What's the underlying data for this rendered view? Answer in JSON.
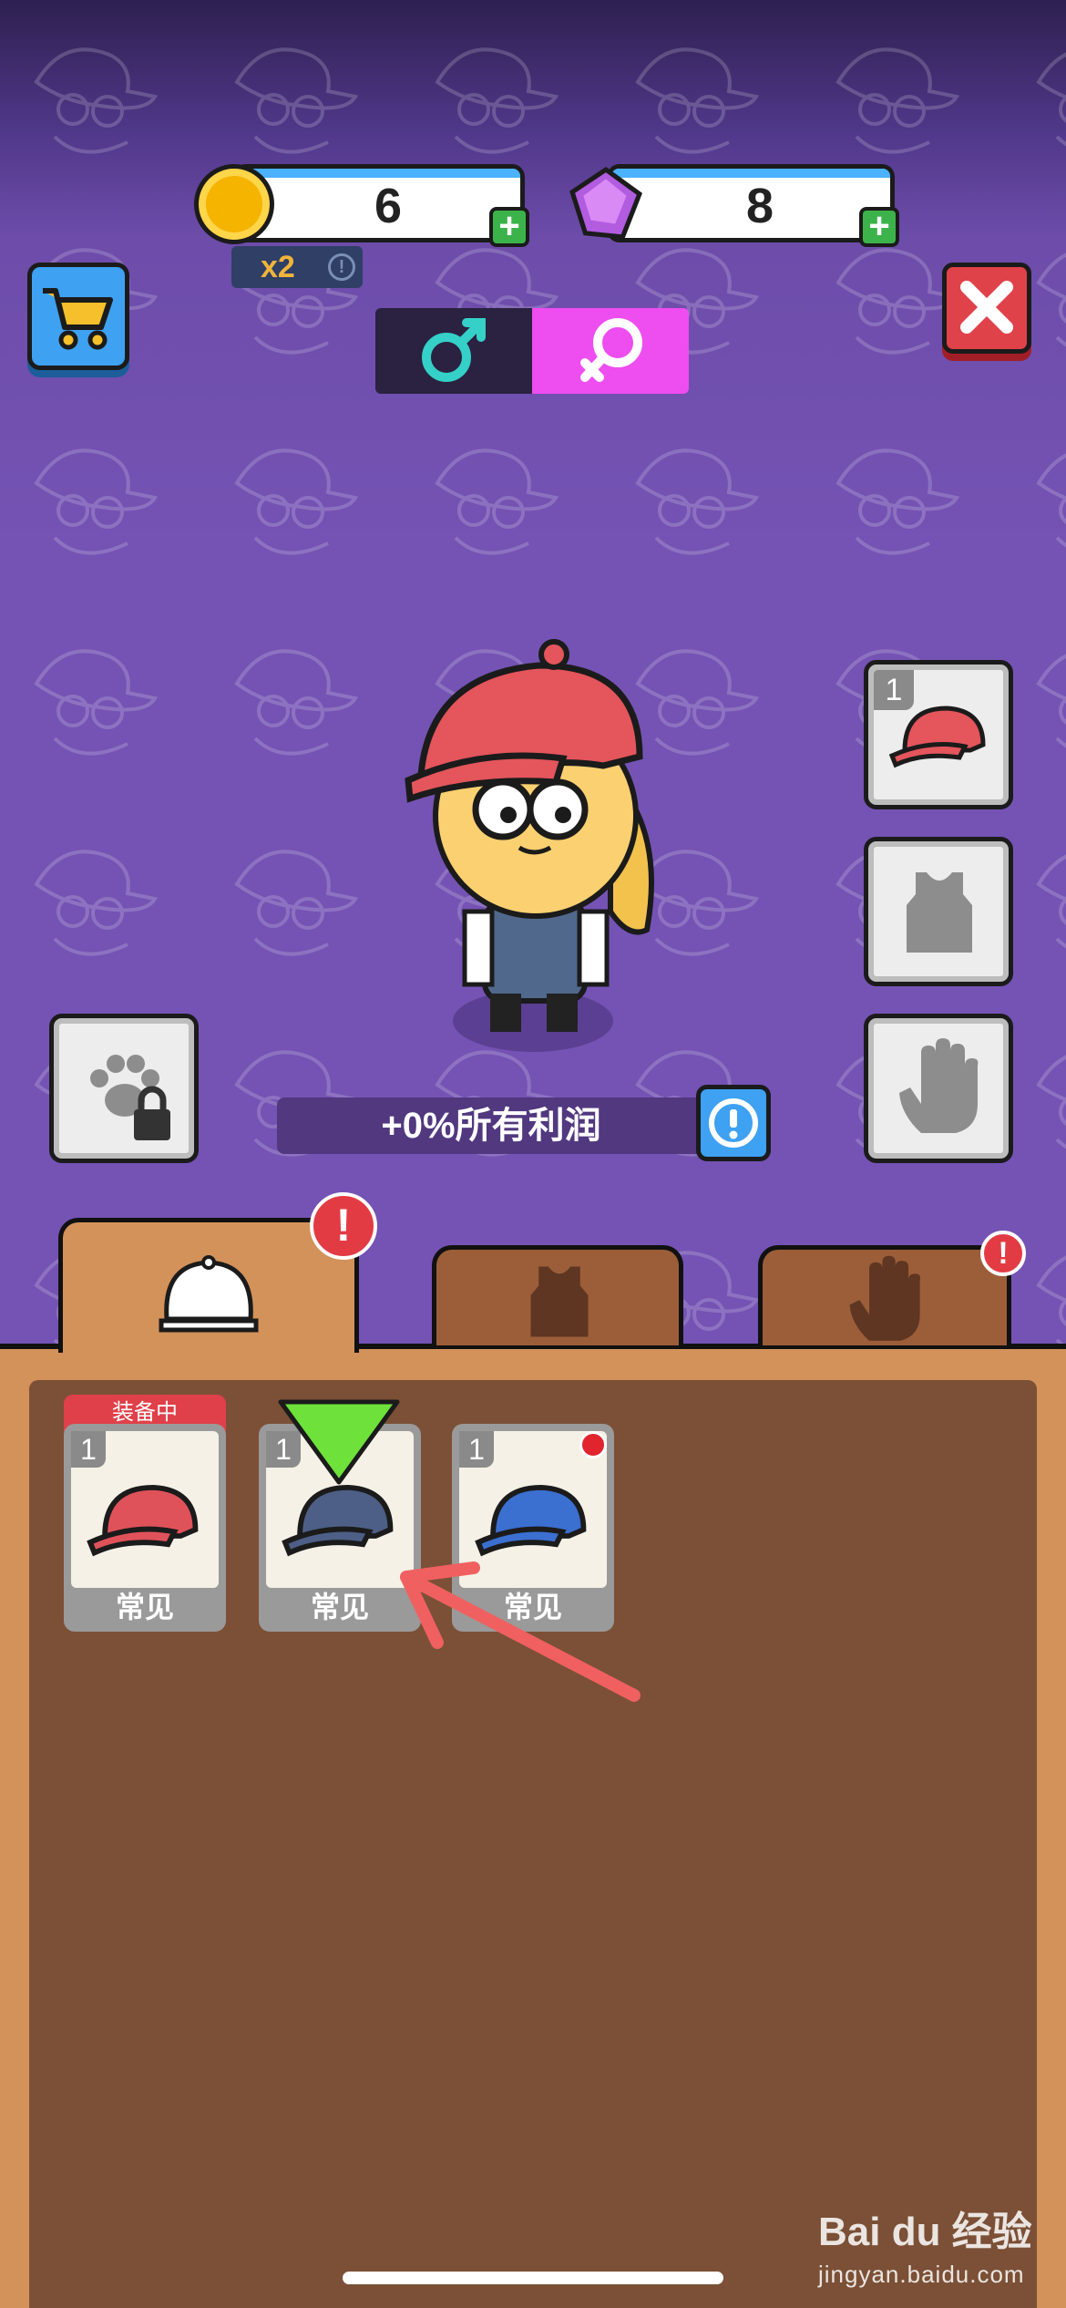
{
  "currency": {
    "coins": "6",
    "gems": "8",
    "multiplier": "x2"
  },
  "profit_text": "+0%所有利润",
  "gender": {
    "male_symbol": "♂",
    "female_symbol": "♀",
    "selected": "female"
  },
  "equipment_slots": [
    {
      "name": "hat",
      "level": "1"
    },
    {
      "name": "shirt",
      "level": ""
    },
    {
      "name": "gloves",
      "level": ""
    }
  ],
  "pet_slot": {
    "locked": true
  },
  "tabs": [
    {
      "name": "hats",
      "active": true,
      "badge": "!"
    },
    {
      "name": "shirts",
      "active": false,
      "badge": ""
    },
    {
      "name": "gloves",
      "active": false,
      "badge": "!"
    }
  ],
  "equipped_label": "装备中",
  "items": [
    {
      "level": "1",
      "rarity": "常见",
      "hat_color": "#e0525a",
      "equipped": true,
      "new_dot": false
    },
    {
      "level": "1",
      "rarity": "常见",
      "hat_color": "#4d5f86",
      "equipped": false,
      "new_dot": false
    },
    {
      "level": "1",
      "rarity": "常见",
      "hat_color": "#3b6fd0",
      "equipped": false,
      "new_dot": true
    }
  ],
  "watermark": {
    "brand": "Bai du 经验",
    "url": "jingyan.baidu.com"
  },
  "colors": {
    "background_purple": "#7453b4",
    "panel_orange": "#d3925a",
    "panel_brown": "#7b5036",
    "accent_blue": "#3ea1f2",
    "close_red": "#e0424a",
    "female_pink": "#ee4df0",
    "annotation_arrow": "#f06060"
  }
}
